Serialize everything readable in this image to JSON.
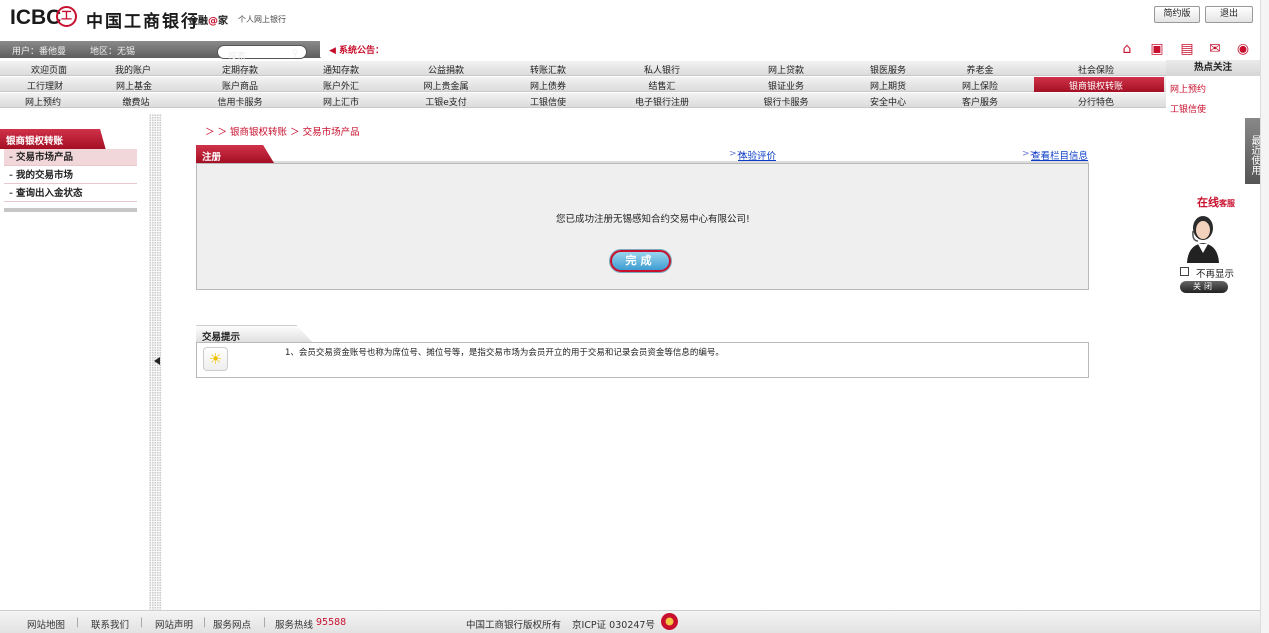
{
  "header": {
    "logo_icbc": "ICBC",
    "logo_symbol": "工",
    "logo_cn": "中国工商银行",
    "logo_jr_a": "金融",
    "logo_jr_at": "@",
    "logo_jr_b": "家",
    "logo_sub": "个人网上银行",
    "simple_version": "简约版",
    "logout": "退出"
  },
  "userbar": {
    "user": "用户：番他曼",
    "region": "地区：无锡",
    "search_label": "搜索",
    "notice": "◀ 系统公告："
  },
  "nav": {
    "row1": [
      "欢迎页面",
      "我的账户",
      "定期存款",
      "通知存款",
      "公益捐款",
      "转账汇款",
      "私人银行",
      "网上贷款",
      "银医服务",
      "养老金",
      "社会保险"
    ],
    "row2": [
      "工行理财",
      "网上基金",
      "账户商品",
      "账户外汇",
      "网上贵金属",
      "网上债券",
      "结售汇",
      "银证业务",
      "网上期货",
      "网上保险",
      "银商银权转账"
    ],
    "row3": [
      "网上预约",
      "缴费站",
      "信用卡服务",
      "网上汇市",
      "工银e支付",
      "工银信使",
      "电子银行注册",
      "银行卡服务",
      "安全中心",
      "客户服务",
      "分行特色"
    ],
    "active_colors": {
      "accent": "#c8102e"
    }
  },
  "hot_focus": {
    "title": "热点关注",
    "items": [
      "网上预约",
      "工银信使"
    ]
  },
  "sidebar": {
    "title": "银商银权转账",
    "items": [
      "交易市场产品",
      "我的交易市场",
      "查询出入金状态"
    ]
  },
  "main": {
    "breadcrumb": "＞ ＞ 银商银权转账 ＞ 交易市场产品",
    "register_tab": "注册",
    "link_pre1": ">>",
    "link1": "体验评价",
    "link_pre2": ">>",
    "link2": "查看栏目信息",
    "success_text": "您已成功注册无锡感知合约交易中心有限公司!",
    "done_button": "完成",
    "tips_tab": "交易提示",
    "tip_text": "1、会员交易资金账号也称为席位号、摊位号等，是指交易市场为会员开立的用于交易和记录会员资金等信息的编号。"
  },
  "right": {
    "recent": "最近使用",
    "cs_title": "在线",
    "cs_title_small": "客服",
    "no_show": "不再显示",
    "close": "关闭"
  },
  "footer": {
    "sitemap": "网站地图",
    "contact": "联系我们",
    "statement": "网站声明",
    "outlets": "服务网点",
    "hotline_label": "服务热线",
    "hotline": "95588",
    "copyright": "中国工商银行版权所有",
    "icp": "京ICP证 030247号"
  },
  "colors": {
    "brand_red": "#c8102e",
    "link_blue": "#0a3cc8",
    "panel_gray": "#efefef"
  }
}
